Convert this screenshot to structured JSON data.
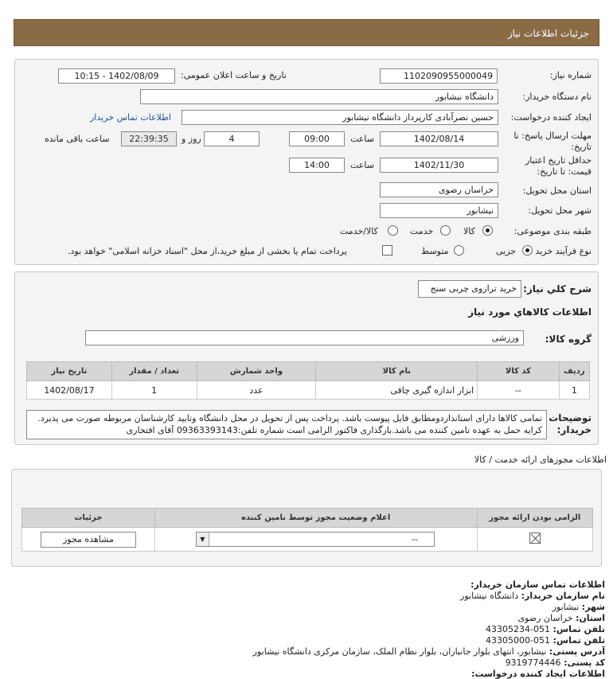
{
  "header": {
    "title": "جزئیات اطلاعات نیاز"
  },
  "form": {
    "need_number_label": "شماره نیاز:",
    "need_number": "1102090955000049",
    "announce_label": "تاریخ و ساعت اعلان عمومی:",
    "announce_value": "1402/08/09 - 10:15",
    "buyer_org_label": "نام دستگاه خریدار:",
    "buyer_org": "دانشگاه نیشابور",
    "creator_label": "ایجاد کننده درخواست:",
    "creator": "حسین نصرآبادی کارپرداز دانشگاه نیشابور",
    "buyer_contact_link": "اطلاعات تماس خریدار",
    "deadline_label_1": "مهلت ارسال پاسخ: تا",
    "deadline_label_2": "تاریخ:",
    "deadline_date": "1402/08/14",
    "time_label": "ساعت",
    "deadline_time": "09:00",
    "days": "4",
    "days_label": "روز و",
    "remaining_time": "22:39:35",
    "remaining_label": "ساعت باقی مانده",
    "validity_label_1": "حداقل تاریخ اعتبار",
    "validity_label_2": "قیمت: تا تاریخ:",
    "validity_date": "1402/11/30",
    "validity_time_label": "ساعت",
    "validity_time": "14:00",
    "province_label": "استان محل تحویل:",
    "province": "خراسان رضوی",
    "city_label": "شهر محل تحویل:",
    "city": "نیشابور",
    "category_label": "طبقه بندی موضوعی:",
    "category_options": [
      "کالا",
      "خدمت",
      "کالا/خدمت"
    ],
    "process_label": "نوع فرآیند خرید :",
    "process_options": [
      "جزیی",
      "متوسط"
    ],
    "payment_note": "پرداخت تمام یا بخشی از مبلغ خرید،از محل \"اسناد خزانه اسلامی\" خواهد بود."
  },
  "need": {
    "summary_label": "شرح کلي نياز:",
    "summary": "خرید ترازوی چربی سنج",
    "goods_info_title": "اطلاعات كالاهاي مورد نياز",
    "goods_group_label": "گروه کالا:",
    "goods_group": "ورزشی",
    "table_headers": [
      "ردیف",
      "کد کالا",
      "نام کالا",
      "واحد شمارش",
      "تعداد / مقدار",
      "تاریخ نیاز"
    ],
    "rows": [
      [
        "1",
        "--",
        "ابزار اندازه گیری چاقی",
        "عدد",
        "1",
        "1402/08/17"
      ]
    ],
    "buyer_notes_label_1": "توضیحات",
    "buyer_notes_label_2": "خریدار:",
    "buyer_notes": "تمامی کالاها دارای استانداردومطابق فایل پیوست باشد. پرداخت پس از تحویل در محل دانشگاه وتایید کارشناسان مربوطه صورت می پذیرد. کرایه حمل به عهده تامین کننده می باشد.بارگذاری فاکتور الزامی است شماره تلفن:09363393143 آقای افتخاری"
  },
  "license": {
    "title": "اطلاعات مجوزهای ارائه خدمت / کالا",
    "headers": [
      "الزامی بودن ارائه مجوز",
      "اعلام وضعیت مجوز توسط نامین کننده",
      "جزئیات"
    ],
    "select_value": "--",
    "view_button": "مشاهده مجوز"
  },
  "contact": {
    "title": "اطلاعات تماس سازمان خریدار:",
    "org_label": "نام سازمان خریدار:",
    "org": "دانشگاه نیشابور",
    "city_label": "شهر:",
    "city": "نیشابور",
    "province_label": "استان:",
    "province": "خراسان رضوی",
    "phone_label": "تلفن تماس:",
    "phone": "051-43305234",
    "fax_label": "تلفن تماس:",
    "fax": "051-43305000",
    "address_label": "آدرس پستی:",
    "address": "نیشابور، انتهای بلوار جانبازان، بلوار نظام الملک، سازمان مرکزی دانشگاه نیشابور",
    "postal_label": "کد پستی:",
    "postal": "9319774446",
    "creator_title": "اطلاعات ایجاد کننده درخواست:"
  }
}
